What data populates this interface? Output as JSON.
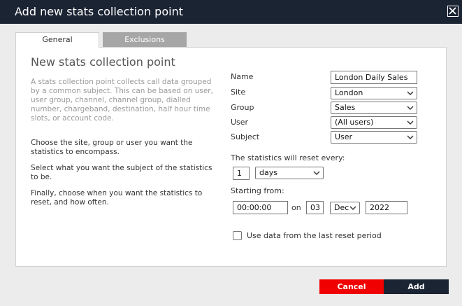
{
  "dialog": {
    "title": "Add new stats collection point"
  },
  "tabs": [
    {
      "label": "General",
      "active": true
    },
    {
      "label": "Exclusions",
      "active": false
    }
  ],
  "panel": {
    "heading": "New stats collection point",
    "description_1": "A stats collection point collects call data grouped by a common subject. This can be based on user, user group, channel, channel group, dialled number, chargeband, destination, half hour time slots, or account code.",
    "description_2": "Choose the site, group or user you want the statistics to encompass.",
    "description_3": "Select what you want the subject of the statistics to be.",
    "description_4": "Finally, choose when you want the statistics to reset, and how often."
  },
  "form": {
    "name_label": "Name",
    "name_value": "London Daily Sales",
    "site_label": "Site",
    "site_value": "London",
    "group_label": "Group",
    "group_value": "Sales",
    "user_label": "User",
    "user_value": "(All users)",
    "subject_label": "Subject",
    "subject_value": "User",
    "reset_label": "The statistics will reset every:",
    "reset_count": "1",
    "reset_unit": "days",
    "starting_label": "Starting from:",
    "start_time": "00:00:00",
    "on_label": "on",
    "start_day": "03",
    "start_month": "Dec",
    "start_year": "2022",
    "use_last_period_label": "Use data from the last reset period",
    "use_last_period_checked": false
  },
  "buttons": {
    "cancel": "Cancel",
    "add": "Add"
  },
  "colors": {
    "titlebar": "#1b2433",
    "cancel": "#f00000",
    "add": "#1b2433"
  }
}
